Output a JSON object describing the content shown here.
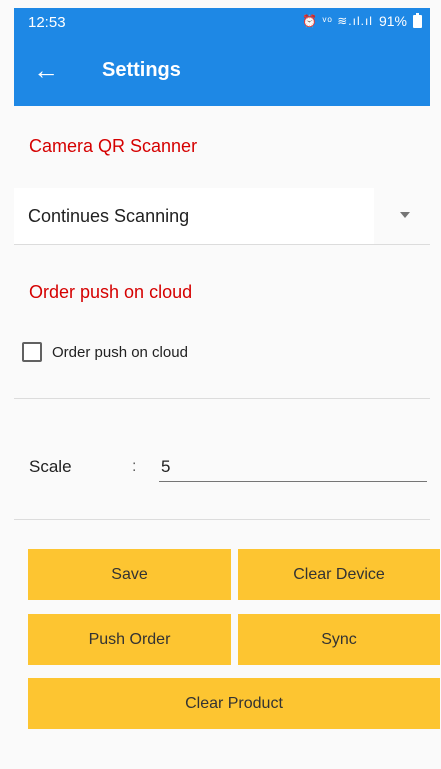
{
  "status_bar": {
    "time": "12:53",
    "icons": "⏰ ᵛᵒ ≋.ıl.ıl",
    "battery": "91%"
  },
  "app_bar": {
    "back_icon": "←",
    "title": "Settings"
  },
  "camera_section": {
    "title": "Camera QR Scanner",
    "dropdown_value": "Continues Scanning"
  },
  "order_section": {
    "title": "Order push on cloud",
    "checkbox_label": "Order push on cloud",
    "checked": false
  },
  "scale": {
    "label": "Scale",
    "separator": ":",
    "value": "5"
  },
  "buttons": {
    "save": "Save",
    "clear_device": "Clear Device",
    "push_order": "Push Order",
    "sync": "Sync",
    "clear_product": "Clear Product"
  },
  "colors": {
    "primary": "#1e88e5",
    "section_title": "#d50000",
    "button": "#fdc531"
  }
}
